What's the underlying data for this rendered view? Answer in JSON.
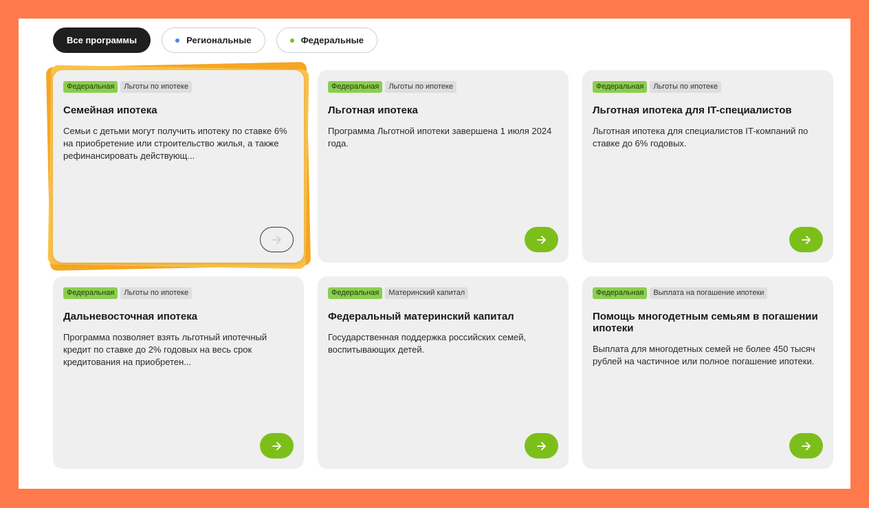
{
  "filters": [
    {
      "label": "Все программы",
      "active": true,
      "dot": ""
    },
    {
      "label": "Региональные",
      "active": false,
      "dot": "#4a86e8"
    },
    {
      "label": "Федеральные",
      "active": false,
      "dot": "#7dbf1a"
    }
  ],
  "cards": [
    {
      "tags": [
        "Федеральная",
        "Льготы по ипотеке"
      ],
      "title": "Семейная ипотека",
      "desc": "Семьи с детьми могут получить ипотеку по ставке 6% на приобретение или строительство жилья, а также рефинансировать действующ..."
    },
    {
      "tags": [
        "Федеральная",
        "Льготы по ипотеке"
      ],
      "title": "Льготная ипотека",
      "desc": "Программа Льготной ипотеки завершена 1 июля 2024 года."
    },
    {
      "tags": [
        "Федеральная",
        "Льготы по ипотеке"
      ],
      "title": "Льготная ипотека для IT-специалистов",
      "desc": "Льготная ипотека для специалистов IT-компаний по ставке до 6% годовых."
    },
    {
      "tags": [
        "Федеральная",
        "Льготы по ипотеке"
      ],
      "title": "Дальневосточная ипотека",
      "desc": "Программа позволяет взять льготный ипотечный кредит по ставке до 2% годовых на весь срок кредитования на приобретен..."
    },
    {
      "tags": [
        "Федеральная",
        "Материнский капитал"
      ],
      "title": "Федеральный материнский капитал",
      "desc": "Государственная поддержка российских семей, воспитывающих детей."
    },
    {
      "tags": [
        "Федеральная",
        "Выплата на погашение ипотеки"
      ],
      "title": "Помощь многодетным семьям в погашении ипотеки",
      "desc": "Выплата для многодетных семей не более 450 тысяч рублей на частичное или полное погашение ипотеки."
    }
  ],
  "colors": {
    "accent_green": "#7dbf1a",
    "tag_green": "#8ccd4f",
    "frame_orange": "#ff7a4a",
    "highlight_orange": "#f6a623"
  }
}
